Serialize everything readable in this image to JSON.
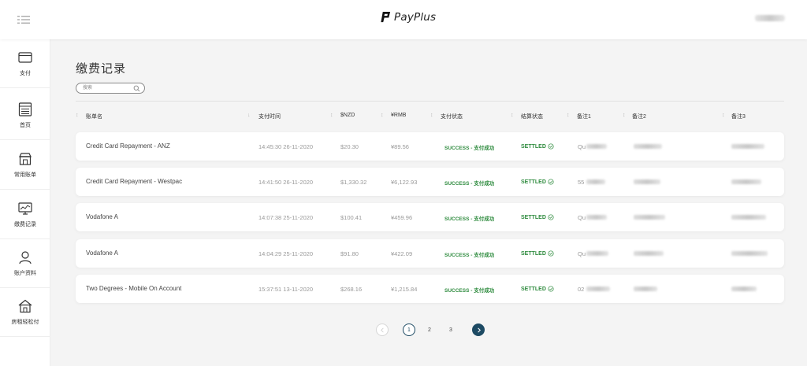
{
  "header": {
    "logo_text": "PayPlus"
  },
  "sidebar": {
    "items": [
      {
        "label": "支付",
        "icon": "card-icon"
      },
      {
        "label": "首页",
        "icon": "list-icon"
      },
      {
        "label": "常用账单",
        "icon": "store-icon"
      },
      {
        "label": "缴费记录",
        "icon": "monitor-icon"
      },
      {
        "label": "账户资料",
        "icon": "user-icon"
      },
      {
        "label": "房租轻松付",
        "icon": "house-icon"
      }
    ]
  },
  "page": {
    "title": "缴费记录",
    "search_placeholder": "搜索"
  },
  "table": {
    "headers": [
      "账单名",
      "支付时间",
      "$NZD",
      "¥RMB",
      "支付状态",
      "结算状态",
      "备注1",
      "备注2",
      "备注3"
    ],
    "rows": [
      {
        "name": "Credit Card Repayment - ANZ",
        "time": "14:45:30 26-11-2020",
        "nzd": "$20.30",
        "rmb": "¥89.56",
        "pay_status": "SUCCESS - 支付成功",
        "settle_status": "SETTLED",
        "note1_prefix": "Qu"
      },
      {
        "name": "Credit Card Repayment - Westpac",
        "time": "14:41:50 26-11-2020",
        "nzd": "$1,330.32",
        "rmb": "¥6,122.93",
        "pay_status": "SUCCESS - 支付成功",
        "settle_status": "SETTLED",
        "note1_prefix": "55"
      },
      {
        "name": "Vodafone A",
        "time": "14:07:38 25-11-2020",
        "nzd": "$100.41",
        "rmb": "¥459.96",
        "pay_status": "SUCCESS - 支付成功",
        "settle_status": "SETTLED",
        "note1_prefix": "Qu"
      },
      {
        "name": "Vodafone A",
        "time": "14:04:29 25-11-2020",
        "nzd": "$91.80",
        "rmb": "¥422.09",
        "pay_status": "SUCCESS - 支付成功",
        "settle_status": "SETTLED",
        "note1_prefix": "Qu"
      },
      {
        "name": "Two Degrees - Mobile On Account",
        "time": "15:37:51 13-11-2020",
        "nzd": "$268.16",
        "rmb": "¥1,215.84",
        "pay_status": "SUCCESS - 支付成功",
        "settle_status": "SETTLED",
        "note1_prefix": "02"
      }
    ]
  },
  "pagination": {
    "pages": [
      "1",
      "2",
      "3"
    ],
    "current": "1",
    "prev_icon": "chevron-left-icon",
    "next_icon": "chevron-right-icon"
  },
  "colors": {
    "success": "#2e8b3e",
    "primary": "#1d4a63"
  }
}
